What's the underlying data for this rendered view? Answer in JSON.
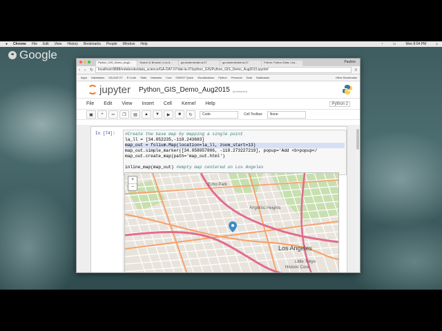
{
  "os": {
    "app": "Chrome",
    "menu": [
      "File",
      "Edit",
      "View",
      "History",
      "Bookmarks",
      "People",
      "Window",
      "Help"
    ],
    "clock": "Mon 8:04 PM"
  },
  "overlay": {
    "brand": "Google"
  },
  "browser": {
    "tabs": [
      {
        "label": "Python_GIS_Demo_Aug2..."
      },
      {
        "label": "Search & Browse | Los A..."
      },
      {
        "label": "ga.students/dat-la-07"
      },
      {
        "label": "ga-students/dat-la-07"
      },
      {
        "label": "Folium: Python Data, Lea..."
      }
    ],
    "user": "Pauline",
    "url": "localhost:8888/notebooks/data_science/GA-DAT-07/dat-la-07/python_GIS/Python_GIS_Demo_Aug2015.ipynb#",
    "bookmarks": [
      "Apps",
      "Databases",
      "GA-DAT-07",
      "R Code",
      "Stats",
      "Datasets",
      "Cool",
      "GWS/IT Quick",
      "Visualizations",
      "Python",
      "Personal",
      "Data",
      "Databases",
      "Other Bookmarks"
    ]
  },
  "jupyter": {
    "logo": "jupyter",
    "notebook_name": "Python_GIS_Demo_Aug2015",
    "autosave": "(autosaved)",
    "menu": [
      "File",
      "Edit",
      "View",
      "Insert",
      "Cell",
      "Kernel",
      "Help"
    ],
    "kernel": "Python 2",
    "cell_type": "Code",
    "cell_toolbar_label": "Cell Toolbar:",
    "cell_toolbar_value": "None",
    "toolbar_icons": [
      "save-icon",
      "add-cell-icon",
      "cut-icon",
      "copy-icon",
      "paste-icon",
      "move-up-icon",
      "move-down-icon",
      "run-icon",
      "stop-icon",
      "restart-icon"
    ]
  },
  "cell": {
    "prompt": "In [74]:",
    "lines": [
      {
        "comment": "#Create the base map by mapping a single point"
      },
      {
        "text": "la_ll = [34.052235,-118.243683]"
      },
      {
        "text": "map_out = folium.Map(location=la_ll, zoom_start=13)",
        "highlight": true
      },
      {
        "text": "map_out.simple_marker([34.058957806, -118.273227219], popup='Add <b>popup</"
      },
      {
        "text": "map_out.create_map(path='map_out.html')"
      },
      {
        "text": ""
      },
      {
        "text": "inline_map(map_out) ",
        "comment": "#empty map centered on Los Angeles"
      }
    ]
  },
  "map": {
    "zoom_in": "+",
    "zoom_out": "−",
    "labels": [
      "Angelino Heights",
      "Los Angeles",
      "Little Tokyo",
      "Historic Core",
      "Echo Park"
    ],
    "land_color": "#e8e4dc",
    "park_color": "#c8dfb0",
    "major_road_color": "#f7a26b",
    "minor_road_color": "#ffffff",
    "highway_color": "#e26b8e",
    "marker_color": "#3d8dc6"
  }
}
